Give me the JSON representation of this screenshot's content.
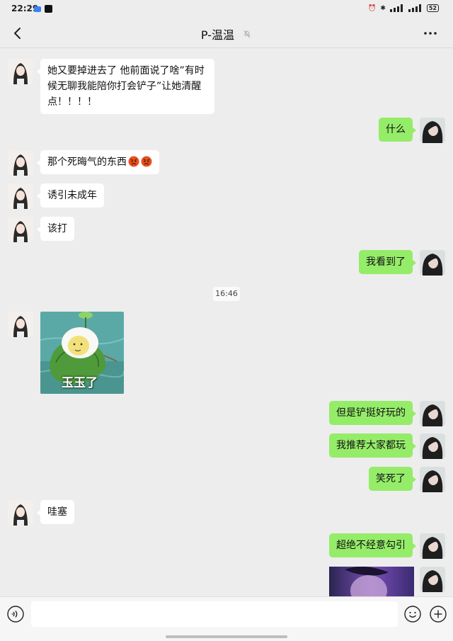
{
  "status_bar": {
    "time": "22:29",
    "battery": "52"
  },
  "chat": {
    "title": "P-温温"
  },
  "messages": [
    {
      "side": "left",
      "type": "text",
      "text": "她又要掉进去了 他前面说了啥”有时候无聊我能陪你打会铲子”让她清醒点！！！！"
    },
    {
      "side": "right",
      "type": "text",
      "text": "什么"
    },
    {
      "side": "left",
      "type": "text",
      "text": "那个死晦气的东西",
      "emoji": "angry-face"
    },
    {
      "side": "left",
      "type": "text",
      "text": "诱引未成年"
    },
    {
      "side": "left",
      "type": "text",
      "text": "该打"
    },
    {
      "side": "right",
      "type": "text",
      "text": "我看到了"
    },
    {
      "type": "timestamp",
      "text": "16:46"
    },
    {
      "side": "left",
      "type": "sticker",
      "text": "玉玉了"
    },
    {
      "side": "right",
      "type": "text",
      "text": "但是铲挺好玩的"
    },
    {
      "side": "right",
      "type": "text",
      "text": "我推荐大家都玩"
    },
    {
      "side": "right",
      "type": "text",
      "text": "笑死了"
    },
    {
      "side": "left",
      "type": "text",
      "text": "哇塞"
    },
    {
      "side": "right",
      "type": "text",
      "text": "超绝不经意勾引"
    },
    {
      "side": "right",
      "type": "image"
    }
  ],
  "input": {
    "value": "",
    "placeholder": ""
  },
  "colors": {
    "background": "#ededed",
    "bubble_right": "#95ec69",
    "bubble_left": "#ffffff"
  }
}
